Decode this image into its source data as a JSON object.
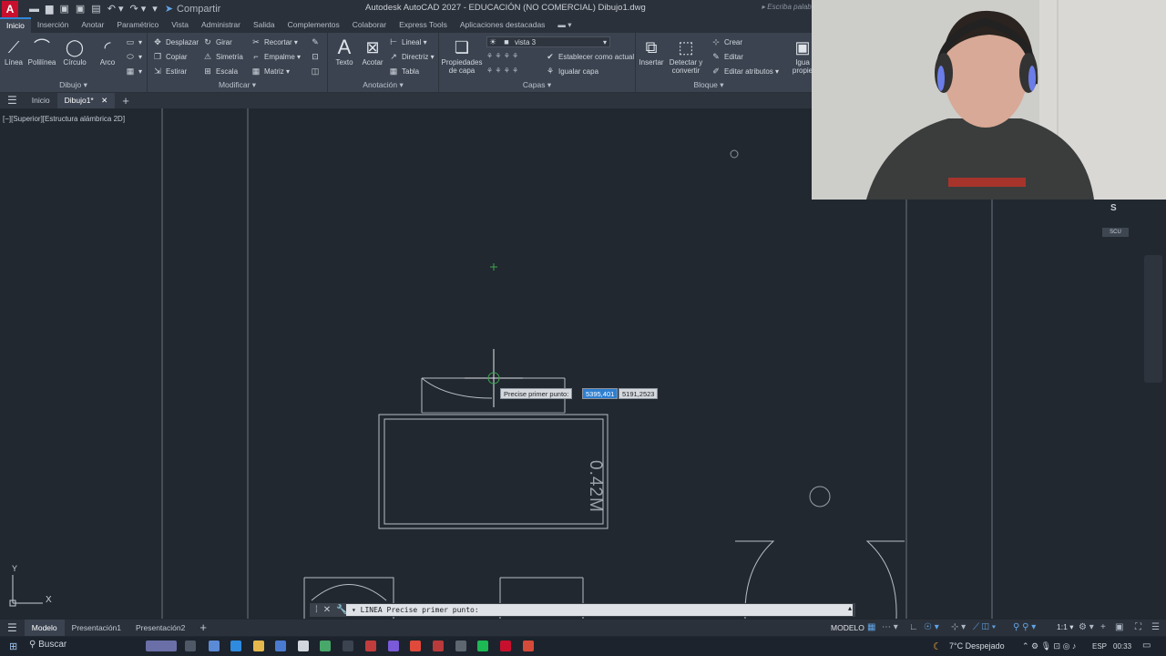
{
  "app": {
    "logo_letter": "A",
    "title": "Autodesk AutoCAD 2027 - EDUCACIÓN (NO COMERCIAL)   Dibujo1.dwg",
    "share": "Compartir",
    "search_placeholder": "Escriba palabr"
  },
  "ribbon_tabs": [
    "Inicio",
    "Inserción",
    "Anotar",
    "Paramétrico",
    "Vista",
    "Administrar",
    "Salida",
    "Complementos",
    "Colaborar",
    "Express Tools",
    "Aplicaciones destacadas"
  ],
  "groups": {
    "dibujo": {
      "title": "Dibujo ▾",
      "linea": "Línea",
      "polilinea": "Polilínea",
      "circulo": "Círculo",
      "arco": "Arco"
    },
    "modificar": {
      "title": "Modificar ▾",
      "desplazar": "Desplazar",
      "girar": "Girar",
      "recortar": "Recortar",
      "copiar": "Copiar",
      "simetria": "Simetría",
      "empalme": "Empalme",
      "estirar": "Estirar",
      "escala": "Escala",
      "matriz": "Matriz"
    },
    "anotacion": {
      "title": "Anotación ▾",
      "texto": "Texto",
      "acotar": "Acotar",
      "lineal": "Lineal",
      "directriz": "Directriz",
      "tabla": "Tabla"
    },
    "capas": {
      "title": "Capas ▾",
      "propiedades": "Propiedades",
      "de_capa": "de capa",
      "layer_name": "vista 3",
      "establecer": "Establecer como actual",
      "igualar": "Igualar capa"
    },
    "bloque": {
      "title": "Bloque ▾",
      "insertar": "Insertar",
      "detectar": "Detectar y",
      "convertir": "convertir",
      "crear": "Crear",
      "editar": "Editar",
      "editar_atributos": "Editar atributos",
      "iguala": "Igua",
      "propie": "propie"
    }
  },
  "file_tabs": {
    "home": "Inicio",
    "active": "Dibujo1*"
  },
  "viewport_label": "[−][Superior][Estructura alámbrica 2D]",
  "cursor": {
    "prompt": "Precise primer punto:",
    "x_value": "5395,401",
    "y_value": "5191,2523"
  },
  "dimension_text": "0.42M",
  "viewcube": {
    "compass": "S",
    "ucs": "SCU"
  },
  "ucs_axes": {
    "y": "Y",
    "x": "X"
  },
  "command_line": {
    "text": "▾ LINEA Precise primer punto:"
  },
  "layout_tabs": [
    "Modelo",
    "Presentación1",
    "Presentación2"
  ],
  "status": {
    "mode": "MODELO",
    "scale": "1:1"
  },
  "taskbar": {
    "search": "Buscar",
    "weather": "7°C  Despejado",
    "lang": "ESP",
    "time": "00:33"
  },
  "colors": {
    "accent": "#2f87d8",
    "canvas": "#212830",
    "ribbon": "#3b4350",
    "logo": "#c8102e"
  }
}
